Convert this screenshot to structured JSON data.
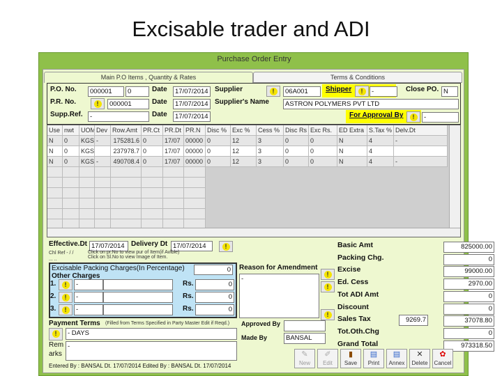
{
  "slide": {
    "title": "Excisable trader and ADI"
  },
  "window": {
    "title": "Purchase Order Entry",
    "colors": {
      "frame": "#8fc04a",
      "panel": "#eef8d0",
      "highlight": "#ffff00",
      "charges": "#bfe3f5"
    }
  },
  "tabs": [
    {
      "label": "Main P.O Items , Quantity & Rates",
      "active": true
    },
    {
      "label": "Terms & Conditions",
      "active": false
    }
  ],
  "header": {
    "po_no_label": "P.O. No.",
    "po_no": "000001",
    "po_sub": "0",
    "pr_no_label": "P.R. No.",
    "pr_no": "000001",
    "supp_ref_label": "Supp.Ref.",
    "supp_ref": "-",
    "date_label": "Date",
    "date1": "17/07/2014",
    "date2": "17/07/2014",
    "date3": "17/07/2014",
    "supplier_label": "Supplier",
    "supplier_code": "06A001",
    "shipper_label": "Shipper",
    "shipper": "-",
    "close_po_label": "Close PO.",
    "close_po": "N",
    "supplier_name_label": "Supplier's Name",
    "supplier_name": "ASTRON POLYMERS PVT LTD",
    "approval_label": "For Approval By",
    "approval": "-"
  },
  "grid": {
    "columns": [
      "Use",
      "nwt",
      "UOM",
      "Dev",
      "Row.Amt",
      "PR.Ct",
      "PR.Dt",
      "PR.N",
      "Disc %",
      "Exc %",
      "Cess %",
      "Disc Rs",
      "Exc Rs.",
      "ED Extra",
      "S.Tax %",
      "Delv.Dt"
    ],
    "rows": [
      [
        "N",
        "0",
        "KGS",
        "-",
        "175281.6",
        "0",
        "17/07",
        "00000",
        "0",
        "12",
        "3",
        "0",
        "0",
        "N",
        "4",
        "-"
      ],
      [
        "N",
        "0",
        "KGS",
        "",
        "237978.7",
        "0",
        "17/07",
        "00000",
        "0",
        "12",
        "3",
        "0",
        "0",
        "N",
        "4",
        ""
      ],
      [
        "N",
        "0",
        "KGS",
        "-",
        "490708.4",
        "0",
        "17/07",
        "00000",
        "0",
        "12",
        "3",
        "0",
        "0",
        "N",
        "4",
        "-"
      ]
    ]
  },
  "bottom": {
    "effective_label": "Effective.Dt",
    "effective": "17/07/2014",
    "delivery_label": "Delivery Dt",
    "delivery": "17/07/2014",
    "chl_ref": "Chl Ref - / /",
    "dots": "... ..",
    "hint1": "Click on pr.No to view pur of Item(if Avlble)",
    "hint2": "Click on Sl.No to view Image of Item.",
    "packing_label": "Excisable Packing Charges(In Percentage)",
    "packing": "0",
    "other_label": "Other Charges",
    "other": [
      {
        "no": "1.",
        "a": "-",
        "b": "",
        "rs": "Rs.",
        "v": "0"
      },
      {
        "no": "2.",
        "a": "-",
        "b": "",
        "rs": "Rs.",
        "v": "0"
      },
      {
        "no": "3.",
        "a": "-",
        "b": "",
        "rs": "Rs.",
        "v": "0"
      }
    ],
    "reason_label": "Reason for Amendment",
    "reason": "-",
    "payment_label": "Payment Terms",
    "payment_note": "(Filled from Terms Specified in Party Master Edit if Reqd.)",
    "payment": "- DAYS",
    "remarks_label1": "Rem",
    "remarks_label2": "arks",
    "remarks": "-",
    "approved_label": "Approved By",
    "approved": "",
    "made_label": "Made By",
    "made": "BANSAL",
    "footer": "Entered By : BANSAL Dt. 17/07/2014   Edited By : BANSAL Dt. 17/07/2014"
  },
  "totals": [
    {
      "label": "Basic Amt",
      "value": "825000.00"
    },
    {
      "label": "Packing Chg.",
      "value": "0"
    },
    {
      "label": "Excise",
      "value": "99000.00"
    },
    {
      "label": "Ed. Cess",
      "value": "2970.00"
    },
    {
      "label": "Tot ADI Amt",
      "value": "0"
    },
    {
      "label": "Discount",
      "value": "0"
    },
    {
      "label": "Sales Tax",
      "value": "37078.80",
      "extra": "9269.7"
    },
    {
      "label": "Tot.Oth.Chg",
      "value": "0"
    },
    {
      "label": "Grand Total",
      "value": "973318.50"
    }
  ],
  "toolbar": [
    {
      "label": "New",
      "icon": "new-icon",
      "glyph": "✎"
    },
    {
      "label": "Edit",
      "icon": "edit-icon",
      "glyph": "✐"
    },
    {
      "label": "Save",
      "icon": "save-icon",
      "glyph": "▮"
    },
    {
      "label": "Print",
      "icon": "print-icon",
      "glyph": "▤"
    },
    {
      "label": "Annex",
      "icon": "annex-icon",
      "glyph": "▤"
    },
    {
      "label": "Delete",
      "icon": "delete-icon",
      "glyph": "✕"
    },
    {
      "label": "Cancel",
      "icon": "cancel-icon",
      "glyph": "✿"
    }
  ]
}
